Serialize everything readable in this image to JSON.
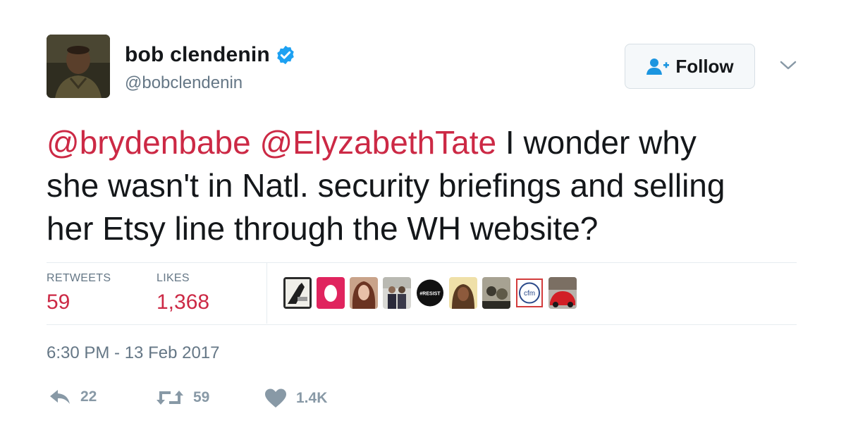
{
  "user": {
    "display_name": "bob clendenin",
    "handle": "@bobclendenin"
  },
  "header": {
    "follow_label": "Follow"
  },
  "tweet": {
    "mention_1": "@brydenbabe",
    "mention_2": "@ElyzabethTate",
    "text_line_1": " I wonder why",
    "text_line_2": "she wasn't in Natl. security briefings and selling",
    "text_line_3": "her Etsy line through the WH website?",
    "timestamp": "6:30 PM - 13 Feb 2017"
  },
  "stats": {
    "retweets_label": "RETWEETS",
    "retweets_value": "59",
    "likes_label": "LIKES",
    "likes_value": "1,368"
  },
  "likers": [
    {
      "name": "liker-1",
      "badge": ""
    },
    {
      "name": "liker-2",
      "badge": ""
    },
    {
      "name": "liker-3",
      "badge": ""
    },
    {
      "name": "liker-4",
      "badge": ""
    },
    {
      "name": "liker-5",
      "badge": "#RESIST"
    },
    {
      "name": "liker-6",
      "badge": ""
    },
    {
      "name": "liker-7",
      "badge": ""
    },
    {
      "name": "liker-8",
      "badge": "cfm"
    },
    {
      "name": "liker-9",
      "badge": ""
    }
  ],
  "actions": {
    "reply_count": "22",
    "retweet_count": "59",
    "like_count": "1.4K"
  },
  "colors": {
    "accent_mention": "#cc2945",
    "verified_blue": "#1da1f2",
    "follow_icon_blue": "#1b95e0",
    "muted_gray": "#657786",
    "action_gray": "#8899a6"
  }
}
